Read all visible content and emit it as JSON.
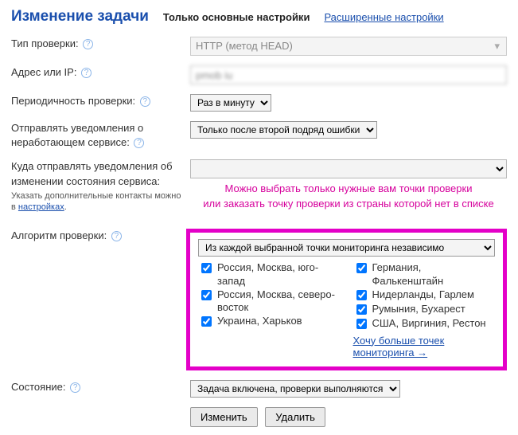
{
  "header": {
    "title": "Изменение задачи",
    "tab_active": "Только основные настройки",
    "tab_link": "Расширенные настройки"
  },
  "labels": {
    "check_type": "Тип проверки:",
    "address": "Адрес или IP:",
    "period": "Периодичность проверки:",
    "notify_down": "Отправлять уведомления о неработающем сервисе:",
    "notify_where": "Куда отправлять уведомления об изменении состояния сервиса:",
    "notify_hint_prefix": "Указать дополнительные контакты можно в ",
    "notify_hint_link": "настройках",
    "notify_hint_suffix": ".",
    "algorithm": "Алгоритм проверки:",
    "state": "Состояние:"
  },
  "values": {
    "check_type": "HTTP (метод HEAD)",
    "address": "pmob iu",
    "period": "Раз в минуту",
    "notify_down": "Только после второй подряд ошибки",
    "notify_where": "",
    "algo_mode": "Из каждой выбранной точки мониторинга независимо",
    "state": "Задача включена, проверки выполняются"
  },
  "annotation": {
    "line1": "Можно выбрать только нужные вам точки проверки",
    "line2": "или заказать точку проверки из страны которой нет в списке"
  },
  "locations": {
    "left": [
      {
        "label": "Россия, Москва, юго-запад",
        "checked": true
      },
      {
        "label": "Россия, Москва, северо-восток",
        "checked": true
      },
      {
        "label": "Украина, Харьков",
        "checked": true
      }
    ],
    "right": [
      {
        "label": "Германия, Фалькенштайн",
        "checked": true
      },
      {
        "label": "Нидерланды, Гарлем",
        "checked": true
      },
      {
        "label": "Румыния, Бухарест",
        "checked": true
      },
      {
        "label": "США, Виргиния, Рестон",
        "checked": true
      }
    ],
    "more_link": "Хочу больше точек мониторинга →"
  },
  "buttons": {
    "submit": "Изменить",
    "delete": "Удалить"
  }
}
